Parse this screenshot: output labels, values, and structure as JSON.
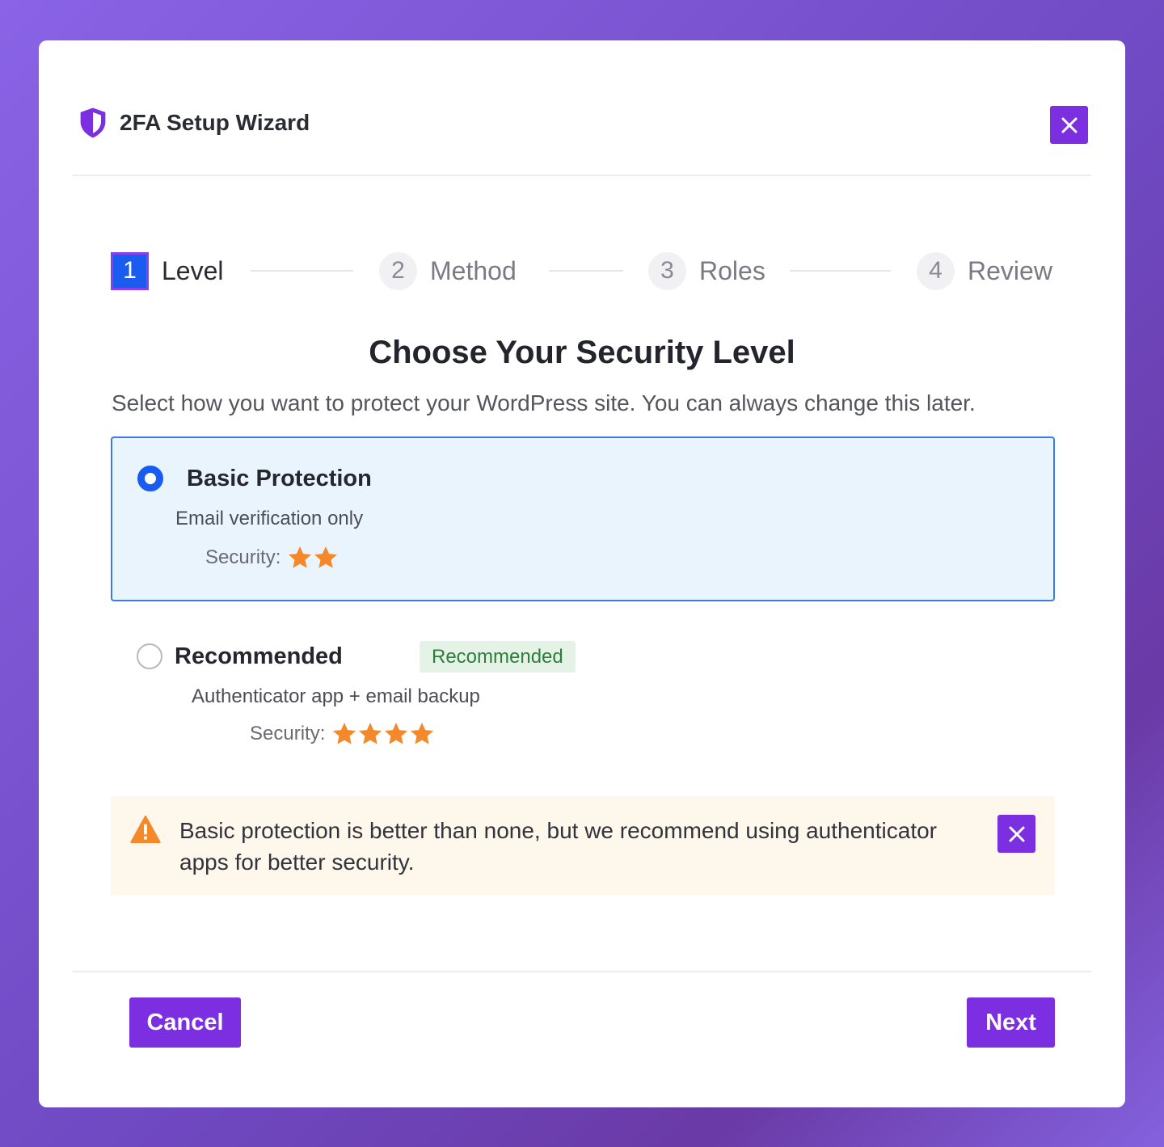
{
  "header": {
    "icon": "shield-icon",
    "title": "2FA Setup Wizard",
    "close_icon": "close-icon"
  },
  "steps": [
    {
      "number": "1",
      "label": "Level",
      "active": true
    },
    {
      "number": "2",
      "label": "Method",
      "active": false
    },
    {
      "number": "3",
      "label": "Roles",
      "active": false
    },
    {
      "number": "4",
      "label": "Review",
      "active": false
    }
  ],
  "main": {
    "heading": "Choose Your Security Level",
    "subheading": "Select how you want to protect your WordPress site. You can always change this later."
  },
  "options": [
    {
      "title": "Basic Protection",
      "description": "Email verification only",
      "security_label": "Security:",
      "stars": 2,
      "selected": true
    },
    {
      "title": "Recommended",
      "badge": "Recommended",
      "description": "Authenticator app + email backup",
      "security_label": "Security:",
      "stars": 4,
      "selected": false
    }
  ],
  "alert": {
    "icon": "warning-icon",
    "text": "Basic protection is better than none, but we recommend using authenticator apps for better security."
  },
  "footer": {
    "cancel_label": "Cancel",
    "next_label": "Next"
  },
  "colors": {
    "accent": "#7b2fe0",
    "selected_blue": "#1a5cf0",
    "star": "#f5892a",
    "badge_bg": "#e4f3e6",
    "badge_text": "#2e7d3a",
    "alert_bg": "#fef7ec"
  }
}
